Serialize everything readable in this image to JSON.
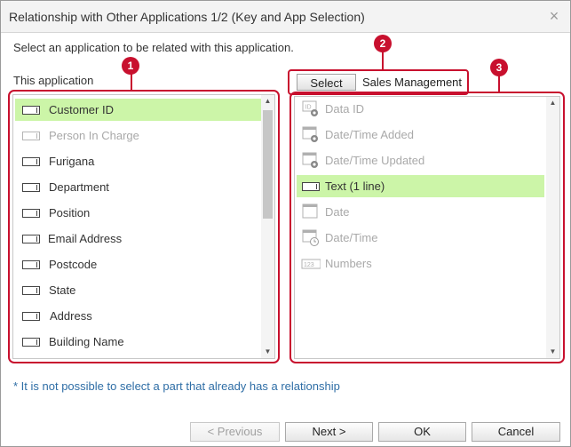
{
  "dialog": {
    "title": "Relationship with Other Applications 1/2 (Key and App Selection)",
    "close_glyph": "×",
    "instruction": "Select an application to be related with this application.",
    "this_app_label": "This application",
    "note": "* It is not possible to select a part that already has a relationship"
  },
  "left_list": {
    "items": [
      {
        "label": "Customer ID",
        "icon": "text-field-icon",
        "state": "selected"
      },
      {
        "label": "Person In Charge",
        "icon": "text-field-icon",
        "state": "disabled"
      },
      {
        "label": "Furigana",
        "icon": "text-field-icon",
        "state": "normal"
      },
      {
        "label": "Department",
        "icon": "text-field-icon",
        "state": "normal"
      },
      {
        "label": "Position",
        "icon": "text-field-icon",
        "state": "normal"
      },
      {
        "label": "Email Address",
        "icon": "text-field-icon",
        "state": "normal"
      },
      {
        "label": "Postcode",
        "icon": "text-field-icon",
        "state": "normal"
      },
      {
        "label": "State",
        "icon": "text-field-icon",
        "state": "normal"
      },
      {
        "label": "Address",
        "icon": "text-field-icon",
        "state": "normal"
      },
      {
        "label": "Building Name",
        "icon": "text-field-icon",
        "state": "normal"
      }
    ]
  },
  "app_select": {
    "button_label": "Select",
    "app_name": "Sales Management"
  },
  "right_list": {
    "items": [
      {
        "label": "Data ID",
        "icon": "data-id-icon",
        "state": "disabled"
      },
      {
        "label": "Date/Time Added",
        "icon": "datetime-added-icon",
        "state": "disabled"
      },
      {
        "label": "Date/Time Updated",
        "icon": "datetime-updated-icon",
        "state": "disabled"
      },
      {
        "label": "Text (1 line)",
        "icon": "text-field-icon",
        "state": "selected"
      },
      {
        "label": "Date",
        "icon": "calendar-icon",
        "state": "disabled"
      },
      {
        "label": "Date/Time",
        "icon": "calendar-clock-icon",
        "state": "disabled"
      },
      {
        "label": "Numbers",
        "icon": "number-field-icon",
        "state": "disabled"
      }
    ]
  },
  "badges": [
    "1",
    "2",
    "3"
  ],
  "buttons": {
    "previous": "< Previous",
    "next": "Next >",
    "ok": "OK",
    "cancel": "Cancel"
  },
  "colors": {
    "highlight": "#c8102e",
    "selected_row": "#ccf5a8",
    "note_text": "#2f6ea6"
  }
}
